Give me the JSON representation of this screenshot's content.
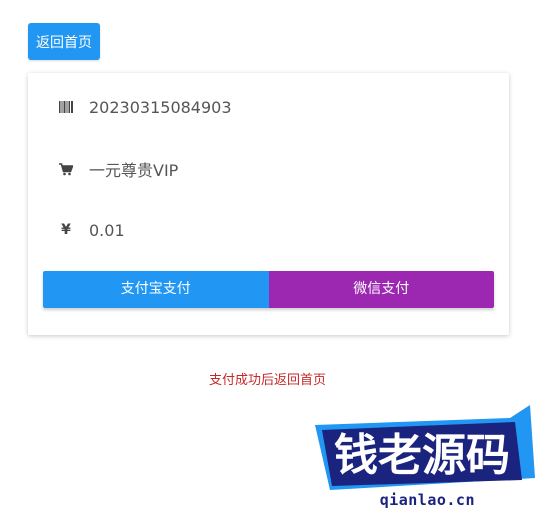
{
  "header": {
    "back_label": "返回首页"
  },
  "order": {
    "order_no": "20230315084903",
    "product": "一元尊贵VIP",
    "price": "0.01",
    "currency_symbol": "¥"
  },
  "payment": {
    "alipay_label": "支付宝支付",
    "wechat_label": "微信支付"
  },
  "hint": "支付成功后返回首页",
  "watermark": {
    "brand": "钱老源码",
    "domain": "qianlao.cn"
  },
  "colors": {
    "primary": "#2196f3",
    "wechat": "#9c27b0",
    "hint": "#c62828",
    "logo_dark": "#1a237e"
  }
}
